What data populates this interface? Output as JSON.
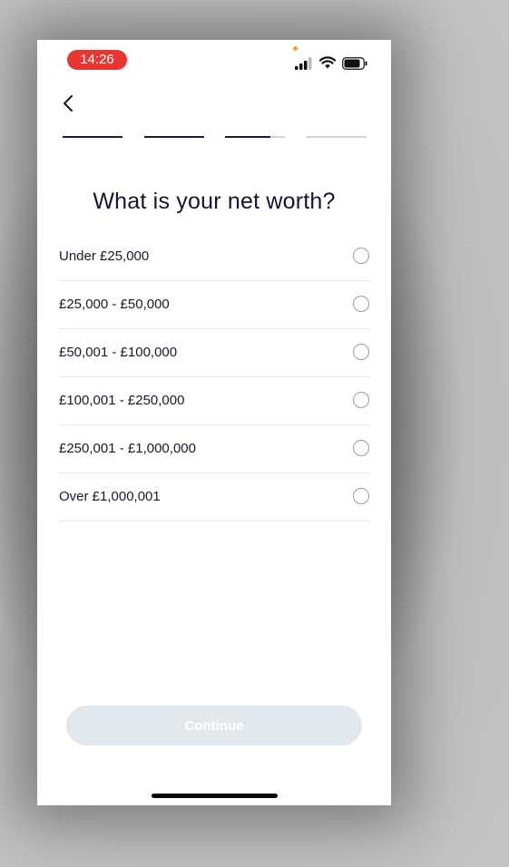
{
  "status_bar": {
    "time": "14:26"
  },
  "header": {
    "back_icon": "chevron-left-icon",
    "progress": [
      1,
      1,
      0.75,
      0
    ]
  },
  "question": {
    "title": "What is your net worth?"
  },
  "options": [
    {
      "label": "Under £25,000",
      "selected": false
    },
    {
      "label": "£25,000 - £50,000",
      "selected": false
    },
    {
      "label": "£50,001 - £100,000",
      "selected": false
    },
    {
      "label": "£100,001 - £250,000",
      "selected": false
    },
    {
      "label": "£250,001 - £1,000,000",
      "selected": false
    },
    {
      "label": "Over £1,000,001",
      "selected": false
    }
  ],
  "footer": {
    "continue_label": "Continue",
    "continue_enabled": false
  },
  "colors": {
    "accent": "#1c1c3c",
    "time_pill": "#e8352f",
    "disabled_button": "#e3e8ec"
  }
}
